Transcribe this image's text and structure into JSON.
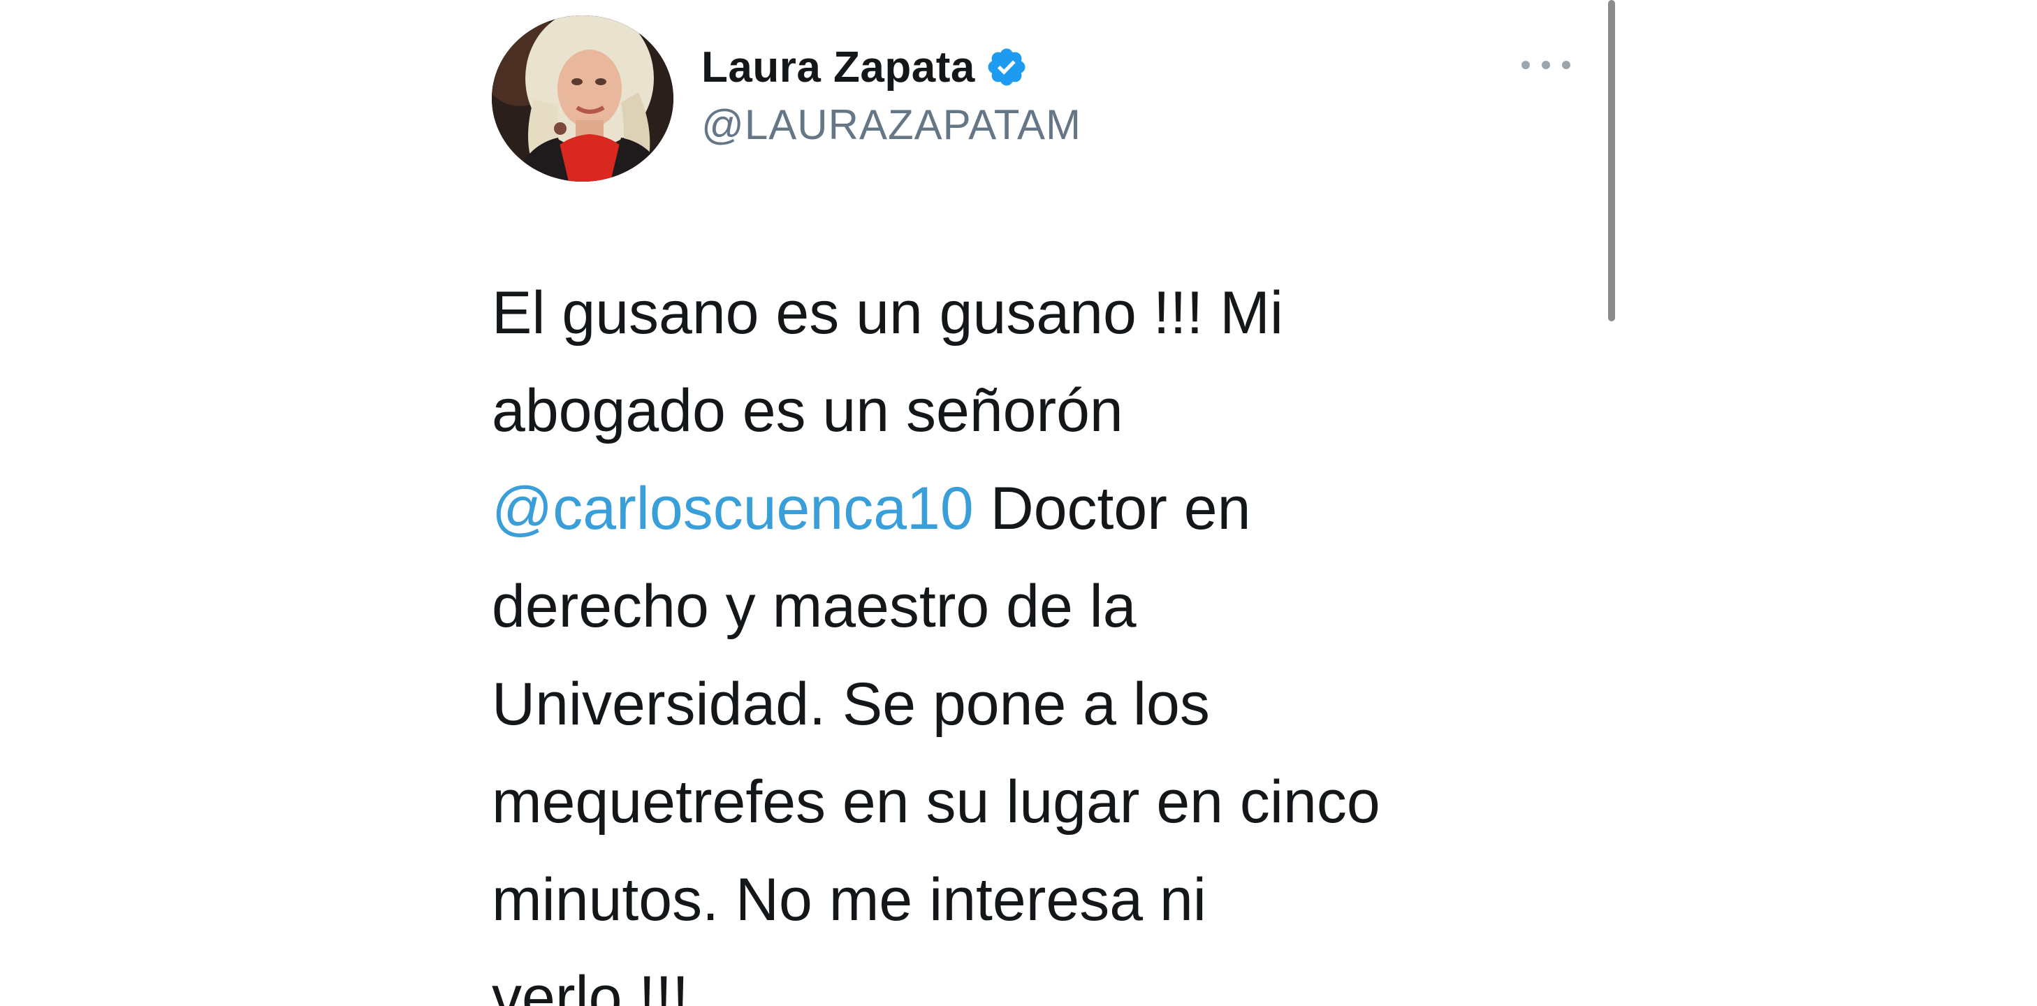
{
  "tweet": {
    "author": {
      "display_name": "Laura Zapata",
      "handle": "@LAURAZAPATAM",
      "verified": true,
      "avatar_icon": "profile-photo",
      "verified_icon": "verified-badge-icon"
    },
    "more_icon": "more-options-icon",
    "text_lines": [
      {
        "parts": [
          {
            "text": "El gusano es un gusano !!! Mi"
          }
        ]
      },
      {
        "parts": [
          {
            "text": "abogado es un señorón"
          }
        ]
      },
      {
        "parts": [
          {
            "text": "@carloscuenca10",
            "mention": true
          },
          {
            "text": " Doctor en"
          }
        ]
      },
      {
        "parts": [
          {
            "text": "derecho y maestro de la"
          }
        ]
      },
      {
        "parts": [
          {
            "text": "Universidad. Se pone a los"
          }
        ]
      },
      {
        "parts": [
          {
            "text": "mequetrefes en su lugar en cinco"
          }
        ]
      },
      {
        "parts": [
          {
            "text": "minutos. No me interesa ni"
          }
        ]
      },
      {
        "parts": [
          {
            "text": "verlo !!!"
          }
        ]
      }
    ]
  },
  "colors": {
    "text": "#14171a",
    "secondary_text": "#657786",
    "mention": "#3a9ed8",
    "verified_badge": "#1d9bf0"
  }
}
